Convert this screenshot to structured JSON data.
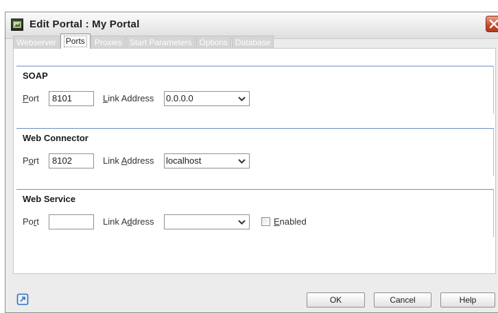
{
  "window": {
    "title": "Edit Portal  : My Portal"
  },
  "tabs": [
    {
      "label": "Webserver",
      "active": false
    },
    {
      "label": "Ports",
      "active": true
    },
    {
      "label": "Proxies",
      "active": false
    },
    {
      "label": "Start Parameters",
      "active": false
    },
    {
      "label": "Options",
      "active": false
    },
    {
      "label": "Database",
      "active": false
    }
  ],
  "groups": {
    "soap": {
      "title": "SOAP",
      "port_label": "Port",
      "port_value": "8101",
      "link_label": "Link Address",
      "link_value": "0.0.0.0"
    },
    "web_connector": {
      "title": "Web Connector",
      "port_label": "Port",
      "port_value": "8102",
      "link_label": "Link Address",
      "link_value": "localhost"
    },
    "web_service": {
      "title": "Web Service",
      "port_label": "Port",
      "port_value": "",
      "link_label": "Link Address",
      "link_value": "",
      "enabled_label": "Enabled",
      "enabled_checked": false
    }
  },
  "buttons": {
    "ok": "OK",
    "cancel": "Cancel",
    "help": "Help"
  },
  "colors": {
    "group_border": "#6a8ec7",
    "close_button": "#c44a2b"
  },
  "icons": {
    "app": "portal-app-icon",
    "close": "close-icon",
    "dropdown": "chevron-down-icon",
    "footer": "restore-window-icon"
  }
}
